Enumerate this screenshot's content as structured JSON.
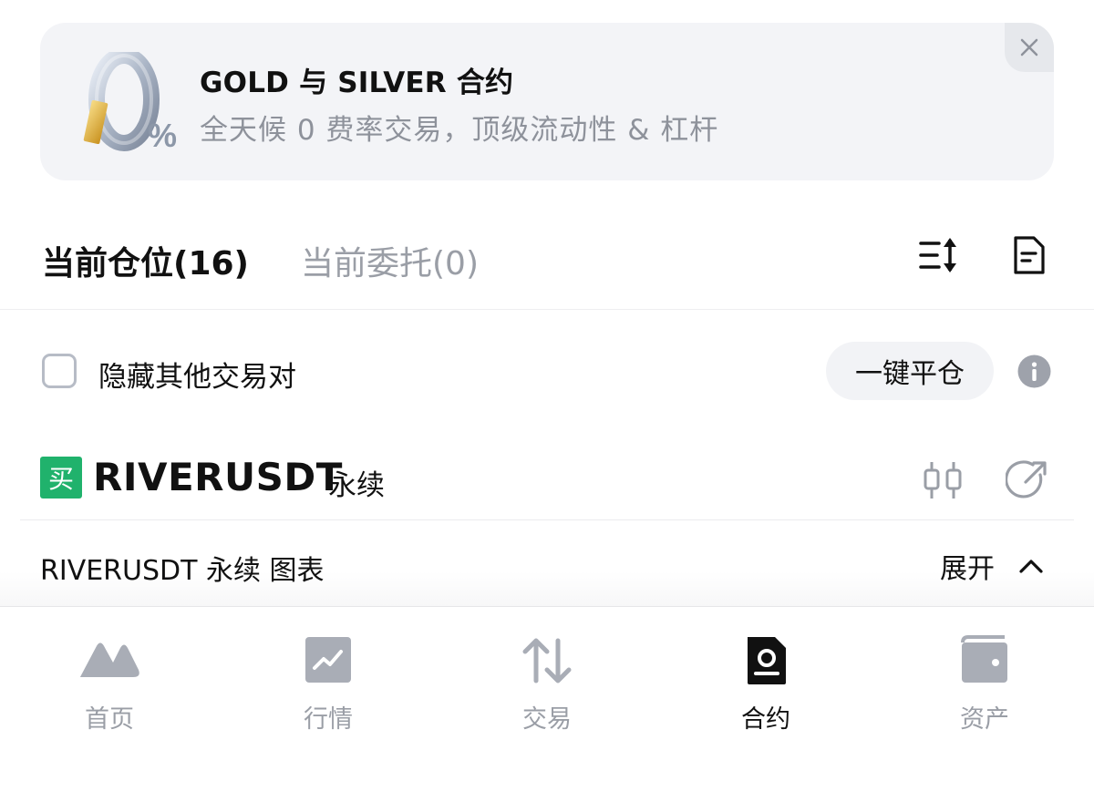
{
  "banner": {
    "title": "GOLD 与 SILVER 合约",
    "subtitle": "全天候 0 费率交易，顶级流动性 & 杠杆",
    "logo_text": "0%"
  },
  "tabs": [
    {
      "label": "当前仓位(16)",
      "active": true
    },
    {
      "label": "当前委托(0)",
      "active": false
    }
  ],
  "filters": {
    "hide_other_pairs_label": "隐藏其他交易对",
    "hide_other_pairs_checked": false,
    "close_all_label": "一键平仓"
  },
  "position": {
    "side_badge": "买",
    "symbol": "RIVERUSDT",
    "type": "永续"
  },
  "chart_section": {
    "label": "RIVERUSDT 永续 图表",
    "toggle_label": "展开"
  },
  "nav": [
    {
      "label": "首页",
      "icon": "home-icon",
      "active": false
    },
    {
      "label": "行情",
      "icon": "market-icon",
      "active": false
    },
    {
      "label": "交易",
      "icon": "trade-icon",
      "active": false
    },
    {
      "label": "合约",
      "icon": "contract-icon",
      "active": true
    },
    {
      "label": "资产",
      "icon": "wallet-icon",
      "active": false
    }
  ],
  "colors": {
    "buy_green": "#20b26c",
    "muted_gray": "#9a9ea6",
    "banner_bg": "#f3f4f7"
  }
}
